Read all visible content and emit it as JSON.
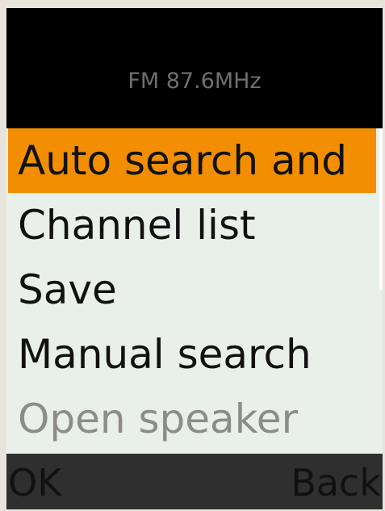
{
  "header": {
    "title": "FM 87.6MHz"
  },
  "menu": {
    "items": [
      {
        "label": "Auto search and",
        "state": "selected"
      },
      {
        "label": "Channel list",
        "state": "normal"
      },
      {
        "label": "Save",
        "state": "normal"
      },
      {
        "label": "Manual search",
        "state": "normal"
      },
      {
        "label": "Open speaker",
        "state": "disabled"
      }
    ]
  },
  "softkeys": {
    "left": "OK",
    "right": "Back"
  },
  "colors": {
    "selection": "#f28e00",
    "menu_bg": "#e9f0ea",
    "header_bg": "#000000",
    "softkey_bar": "#2f2f2f"
  }
}
